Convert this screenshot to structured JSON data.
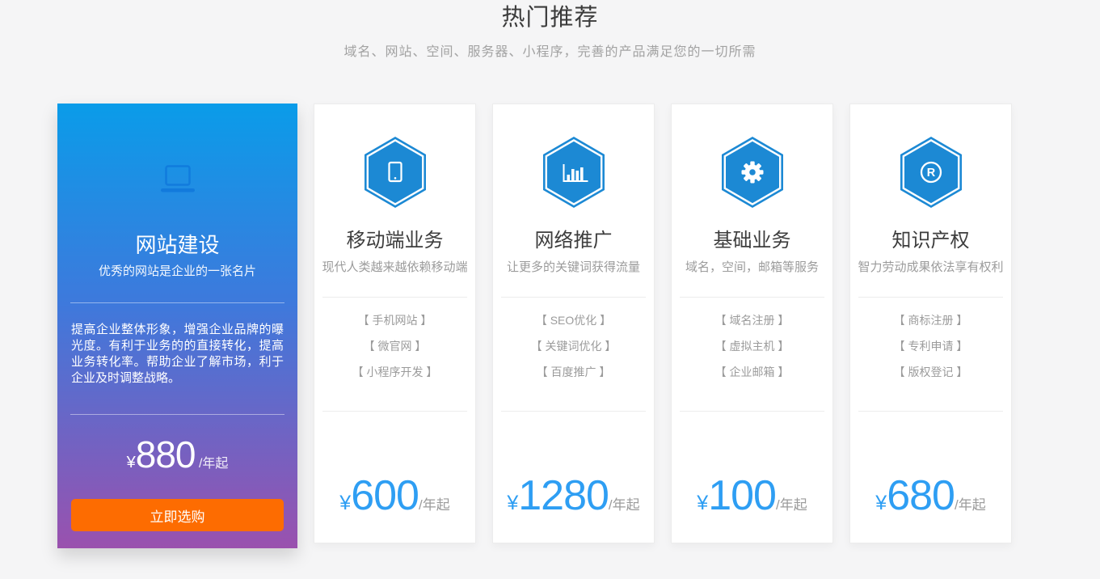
{
  "header": {
    "title": "热门推荐",
    "subtitle": "域名、网站、空间、服务器、小程序，完善的产品满足您的一切所需"
  },
  "featured_card": {
    "icon": "laptop-icon",
    "title": "网站建设",
    "subtitle": "优秀的网站是企业的一张名片",
    "description": "提高企业整体形象，增强企业品牌的曝光度。有利于业务的的直接转化，提高业务转化率。帮助企业了解市场，利于企业及时调整战略。",
    "currency": "¥",
    "price": "880",
    "unit": "/年起",
    "button_label": "立即选购"
  },
  "cards": [
    {
      "icon": "smartphone-icon",
      "title": "移动端业务",
      "subtitle": "现代人类越来越依赖移动端",
      "items": [
        "【 手机网站 】",
        "【 微官网 】",
        "【 小程序开发 】"
      ],
      "currency": "¥",
      "price": "600",
      "unit": "/年起"
    },
    {
      "icon": "bar-chart-icon",
      "title": "网络推广",
      "subtitle": "让更多的关键词获得流量",
      "items": [
        "【 SEO优化 】",
        "【 关键词优化 】",
        "【 百度推广 】"
      ],
      "currency": "¥",
      "price": "1280",
      "unit": "/年起"
    },
    {
      "icon": "gear-icon",
      "title": "基础业务",
      "subtitle": "域名，空间，邮箱等服务",
      "items": [
        "【 域名注册 】",
        "【 虚拟主机 】",
        "【 企业邮箱 】"
      ],
      "currency": "¥",
      "price": "100",
      "unit": "/年起"
    },
    {
      "icon": "registered-trademark-icon",
      "title": "知识产权",
      "subtitle": "智力劳动成果依法享有权利",
      "items": [
        "【 商标注册 】",
        "【 专利申请 】",
        "【 版权登记 】"
      ],
      "currency": "¥",
      "price": "680",
      "unit": "/年起"
    }
  ],
  "colors": {
    "hexagon_blue": "#1C89D4",
    "price_blue": "#2E9EF3",
    "button_orange": "#FD6C01",
    "featured_gradient_top": "#0A9CE9",
    "featured_gradient_bottom": "#9A51AE",
    "page_background": "#F5F5F6",
    "title_gray": "#3B3B3B",
    "text_gray": "#9B9B9B"
  }
}
